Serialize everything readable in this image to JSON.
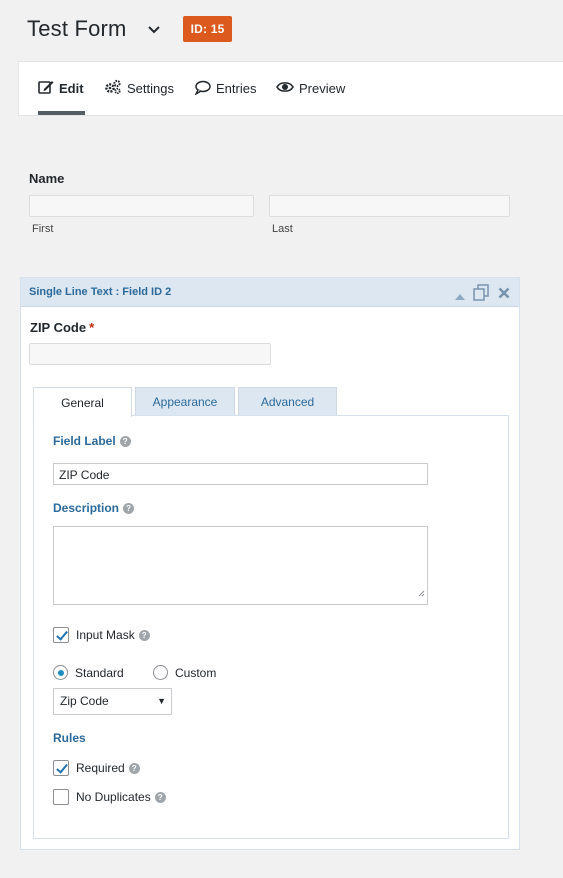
{
  "header": {
    "form_title": "Test Form",
    "id_badge": "ID: 15",
    "colors": {
      "badge": "#dd5a1e"
    }
  },
  "toolbar": {
    "tabs": [
      {
        "label": "Edit",
        "icon": "edit-icon",
        "active": true
      },
      {
        "label": "Settings",
        "icon": "gears-icon",
        "active": false
      },
      {
        "label": "Entries",
        "icon": "comment-icon",
        "active": false
      },
      {
        "label": "Preview",
        "icon": "eye-icon",
        "active": false
      }
    ]
  },
  "name_field": {
    "label": "Name",
    "first_label": "First",
    "last_label": "Last",
    "first_value": "",
    "last_value": ""
  },
  "field_editor": {
    "header_title": "Single Line Text : Field ID 2",
    "field_label": "ZIP Code",
    "required_marker": "*",
    "preview_value": "",
    "tabs": [
      "General",
      "Appearance",
      "Advanced"
    ],
    "active_tab": "General",
    "general": {
      "field_label_heading": "Field Label",
      "field_label_value": "ZIP Code",
      "description_heading": "Description",
      "description_value": "",
      "input_mask_label": "Input Mask",
      "input_mask_checked": true,
      "mask_type_options": [
        "Standard",
        "Custom"
      ],
      "mask_type_selected": "Standard",
      "mask_select_value": "Zip Code",
      "rules_heading": "Rules",
      "required_label": "Required",
      "required_checked": true,
      "no_duplicates_label": "No Duplicates",
      "no_duplicates_checked": false
    }
  }
}
